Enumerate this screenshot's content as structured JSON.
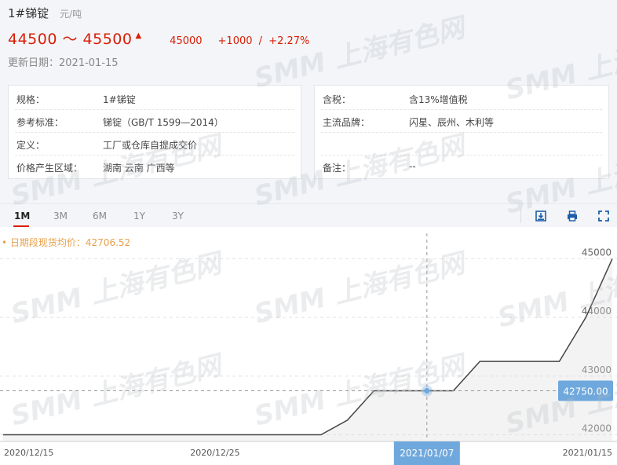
{
  "header": {
    "title": "1#锑锭",
    "unit": "元/吨",
    "price_range": "44500 ～ 45500",
    "avg_price": "45000",
    "change": "+1000",
    "separator": "/",
    "change_pct": "+2.27%",
    "update_label": "更新日期：2021-01-15"
  },
  "info_left": [
    {
      "k": "规格：",
      "v": "1#锑锭"
    },
    {
      "k": "参考标准：",
      "v": "锑锭（GB/T 1599—2014）"
    },
    {
      "k": "定义：",
      "v": "工厂或仓库自提成交价"
    },
    {
      "k": "价格产生区域：",
      "v": "湖南 云南 广西等"
    }
  ],
  "info_right": [
    {
      "k": "含税：",
      "v": "含13%增值税"
    },
    {
      "k": "主流品牌：",
      "v": "闪星、辰州、木利等"
    },
    {
      "k": "",
      "v": ""
    },
    {
      "k": "备注：",
      "v": "--"
    }
  ],
  "tabs": [
    "1M",
    "3M",
    "6M",
    "1Y",
    "3Y"
  ],
  "active_tab": "1M",
  "toolbar_icons": [
    "download-icon",
    "print-icon",
    "fullscreen-icon"
  ],
  "watermark": "SMM 上海有色网",
  "colors": {
    "up": "#d81e06",
    "line": "#444444",
    "tooltip": "#6fa8dc",
    "legend": "#e8a04a"
  },
  "chart_data": {
    "type": "line",
    "legend": "日期段现货均价：42706.52",
    "x": [
      "2020/12/15",
      "2020/12/16",
      "2020/12/17",
      "2020/12/18",
      "2020/12/21",
      "2020/12/22",
      "2020/12/23",
      "2020/12/24",
      "2020/12/25",
      "2020/12/28",
      "2020/12/29",
      "2020/12/30",
      "2020/12/31",
      "2021/01/04",
      "2021/01/05",
      "2021/01/06",
      "2021/01/07",
      "2021/01/08",
      "2021/01/11",
      "2021/01/12",
      "2021/01/13",
      "2021/01/14",
      "2021/01/15"
    ],
    "values": [
      42000,
      42000,
      42000,
      42000,
      42000,
      42000,
      42000,
      42000,
      42000,
      42000,
      42000,
      42000,
      42000,
      42250,
      42750,
      42750,
      42750,
      42750,
      43250,
      43250,
      43250,
      43250,
      44000,
      45000
    ],
    "x_tick_labels": [
      "2020/12/15",
      "2020/12/25",
      "2021/01/15"
    ],
    "y_ticks": [
      42000,
      43000,
      44000,
      45000
    ],
    "ylim": [
      41900,
      45300
    ],
    "highlight": {
      "x": "2021/01/07",
      "value": "42750.00"
    },
    "grid": "horizontal-dashed"
  }
}
